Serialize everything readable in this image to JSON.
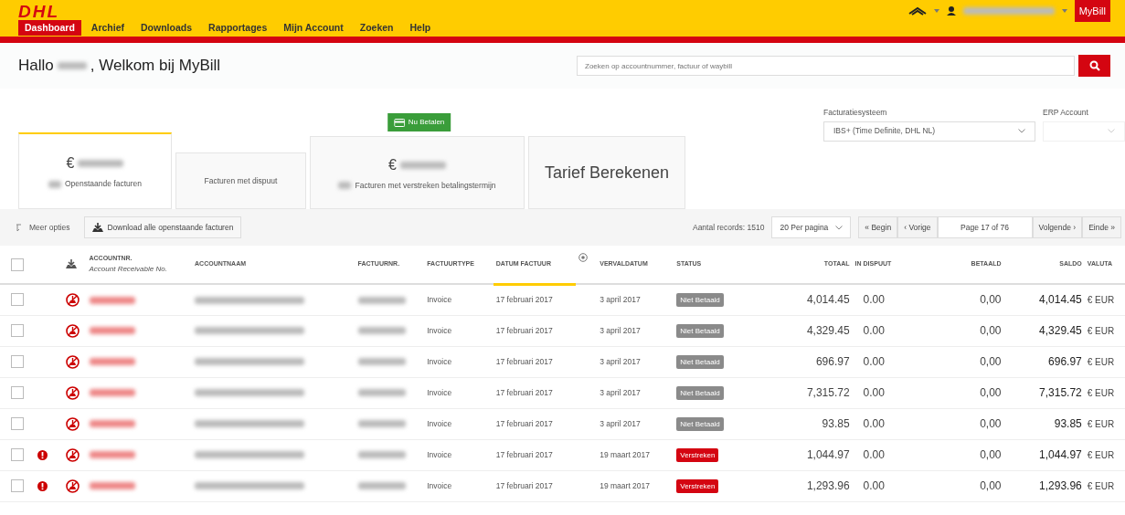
{
  "header": {
    "logo_text": "DHL",
    "nav": [
      {
        "label": "Dashboard",
        "selected": true
      },
      {
        "label": "Archief",
        "selected": false
      },
      {
        "label": "Downloads",
        "selected": false
      },
      {
        "label": "Rapportages",
        "selected": false
      },
      {
        "label": "Mijn Account",
        "selected": false
      },
      {
        "label": "Zoeken",
        "selected": false
      },
      {
        "label": "Help",
        "selected": false
      }
    ],
    "app_badge": "MyBill"
  },
  "greeting": {
    "prefix": "Hallo",
    "suffix": ", Welkom bij MyBill"
  },
  "search": {
    "placeholder": "Zoeken op accountnummer, factuur of waybill"
  },
  "summary_cards": [
    {
      "kind": "amount",
      "currency": "€",
      "label": "Openstaande facturen",
      "selected": true
    },
    {
      "kind": "label",
      "label": "Facturen met dispuut",
      "selected": false
    },
    {
      "kind": "amount",
      "currency": "€",
      "label": "Facturen met verstreken betalingstermijn",
      "badge": "Nu Betalen",
      "selected": false
    },
    {
      "kind": "title",
      "label": "Tarief Berekenen",
      "selected": false
    }
  ],
  "filters": [
    {
      "label": "Facturatiesysteem",
      "value": "IBS+ (Time Definite, DHL NL)",
      "disabled": false
    },
    {
      "label": "ERP Account",
      "disabled": true
    }
  ],
  "toolbar": {
    "more_options": "Meer opties",
    "download_button": "Download alle openstaande facturen",
    "record_count": "Aantal records: 1510",
    "per_page": "20 Per pagina",
    "pager_prev": [
      "« Begin",
      "‹ Vorige"
    ],
    "page_label": "Page 17 of 76",
    "pager_next": [
      "Volgende ›",
      "Einde »"
    ]
  },
  "table": {
    "columns": [
      {
        "kind": "check",
        "checked": false
      },
      {
        "kind": "alert"
      },
      {
        "kind": "download"
      },
      {
        "kind": "text",
        "label": "ACCOUNTNR.",
        "sublabel": "Account Receivable No.",
        "sorted": false
      },
      {
        "kind": "text",
        "label": "ACCOUNTNAAM",
        "sorted": false
      },
      {
        "kind": "text",
        "label": "FACTUURNR.",
        "sorted": false
      },
      {
        "kind": "text",
        "label": "FACTUURTYPE",
        "sorted": false
      },
      {
        "kind": "text",
        "label": "DATUM FACTUUR",
        "sorted": true
      },
      {
        "kind": "sort"
      },
      {
        "kind": "text",
        "label": "VERVALDATUM",
        "sorted": false
      },
      {
        "kind": "text",
        "label": "STATUS",
        "sorted": false
      },
      {
        "kind": "num",
        "label": "TOTAAL",
        "sorted": false
      },
      {
        "kind": "text",
        "label": "IN DISPUUT",
        "sorted": false
      },
      {
        "kind": "num",
        "label": "BETAALD",
        "sorted": false
      },
      {
        "kind": "num",
        "label": "SALDO",
        "sorted": false
      },
      {
        "kind": "text",
        "label": "VALUTA",
        "sorted": false
      }
    ],
    "rows": [
      {
        "checked": false,
        "alert": false,
        "type": "Invoice",
        "invoice_date": "17 februari 2017",
        "due_date": "3 april 2017",
        "status": "Niet Betaald",
        "color": "#8a8a8a",
        "total": "4,014.45",
        "in_dispute": "0.00",
        "paid": "0,00",
        "balance": "4,014.45",
        "currency": "€ EUR"
      },
      {
        "checked": false,
        "alert": false,
        "type": "Invoice",
        "invoice_date": "17 februari 2017",
        "due_date": "3 april 2017",
        "status": "Niet Betaald",
        "color": "#8a8a8a",
        "total": "4,329.45",
        "in_dispute": "0.00",
        "paid": "0,00",
        "balance": "4,329.45",
        "currency": "€ EUR"
      },
      {
        "checked": false,
        "alert": false,
        "type": "Invoice",
        "invoice_date": "17 februari 2017",
        "due_date": "3 april 2017",
        "status": "Niet Betaald",
        "color": "#8a8a8a",
        "total": "696.97",
        "in_dispute": "0.00",
        "paid": "0,00",
        "balance": "696.97",
        "currency": "€ EUR"
      },
      {
        "checked": false,
        "alert": false,
        "type": "Invoice",
        "invoice_date": "17 februari 2017",
        "due_date": "3 april 2017",
        "status": "Niet Betaald",
        "color": "#8a8a8a",
        "total": "7,315.72",
        "in_dispute": "0.00",
        "paid": "0,00",
        "balance": "7,315.72",
        "currency": "€ EUR"
      },
      {
        "checked": false,
        "alert": false,
        "type": "Invoice",
        "invoice_date": "17 februari 2017",
        "due_date": "3 april 2017",
        "status": "Niet Betaald",
        "color": "#8a8a8a",
        "total": "93.85",
        "in_dispute": "0.00",
        "paid": "0,00",
        "balance": "93.85",
        "currency": "€ EUR"
      },
      {
        "checked": false,
        "alert": true,
        "type": "Invoice",
        "invoice_date": "17 februari 2017",
        "due_date": "19 maart 2017",
        "status": "Verstreken",
        "color": "#d40511",
        "total": "1,044.97",
        "in_dispute": "0.00",
        "paid": "0,00",
        "balance": "1,044.97",
        "currency": "€ EUR"
      },
      {
        "checked": false,
        "alert": true,
        "type": "Invoice",
        "invoice_date": "17 februari 2017",
        "due_date": "19 maart 2017",
        "status": "Verstreken",
        "color": "#d40511",
        "total": "1,293.96",
        "in_dispute": "0.00",
        "paid": "0,00",
        "balance": "1,293.96",
        "currency": "€ EUR"
      }
    ]
  }
}
